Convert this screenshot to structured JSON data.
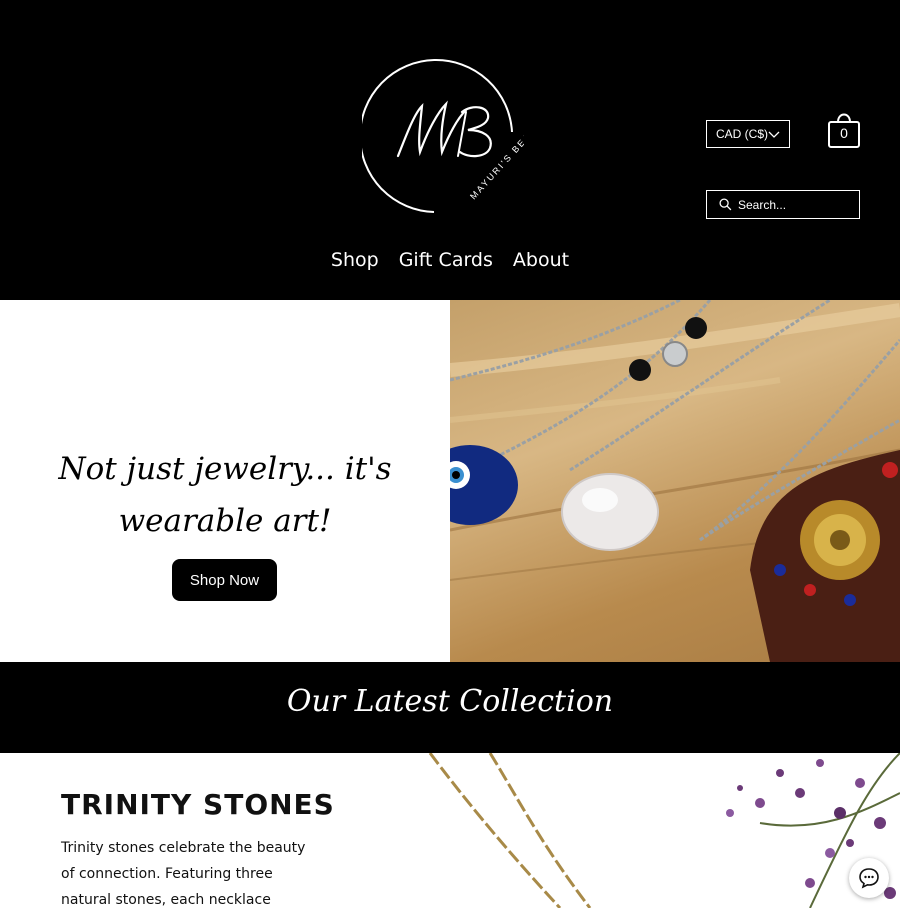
{
  "header": {
    "logo_monogram": "MB",
    "logo_text": "MAYURI'S BEADS",
    "currency": "CAD (C$)",
    "cart_count": "0",
    "search_placeholder": "Search...",
    "nav": [
      "Shop",
      "Gift Cards",
      "About"
    ]
  },
  "hero": {
    "tagline_line1": "Not just jewelry... it's",
    "tagline_line2": "wearable art!",
    "cta_label": "Shop Now"
  },
  "collection": {
    "heading": "Our Latest Collection"
  },
  "product": {
    "title": "TRINITY STONES",
    "description": "Trinity stones celebrate the beauty of connection. Featuring three natural stones, each necklace showcases raw"
  },
  "icons": {
    "chevron": "chevron-down-icon",
    "cart": "shopping-bag-icon",
    "search": "search-icon",
    "chat": "chat-icon"
  },
  "colors": {
    "header_bg": "#000000",
    "text_light": "#ffffff",
    "button_bg": "#000000"
  }
}
